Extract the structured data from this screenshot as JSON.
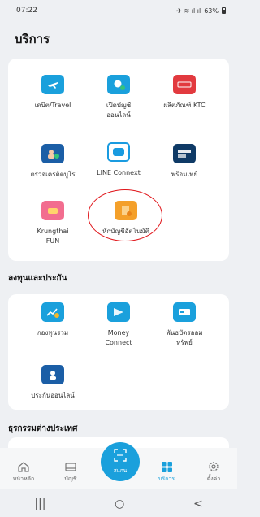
{
  "status_bar": {
    "time": "07:22",
    "icons_text": "✈︎ ≋ ıl ıl",
    "battery": "63%"
  },
  "page": {
    "title": "บริการ"
  },
  "services": [
    {
      "label": "เดบิต/Travel",
      "icon": "travel-card-icon"
    },
    {
      "label": "เปิดบัญชี\nออนไลน์",
      "icon": "open-account-icon"
    },
    {
      "label": "ผลิตภัณฑ์ KTC",
      "icon": "ktc-icon"
    },
    {
      "label": "ตรวจเครดิตบูโร",
      "icon": "credit-bureau-icon"
    },
    {
      "label": "LINE Connext",
      "icon": "line-connext-icon"
    },
    {
      "label": "พร้อมเพย์",
      "icon": "promptpay-icon"
    },
    {
      "label": "Krungthai\nFUN",
      "icon": "krungthai-fun-icon"
    },
    {
      "label": "หักบัญชีอัตโนมัติ",
      "icon": "auto-debit-icon"
    }
  ],
  "invest_section": {
    "title": "ลงทุนและประกัน",
    "items": [
      {
        "label": "กองทุนรวม",
        "icon": "mutual-fund-icon"
      },
      {
        "label": "Money\nConnect",
        "icon": "money-connect-icon"
      },
      {
        "label": "พันธบัตรออม\nทรัพย์",
        "icon": "savings-bond-icon"
      },
      {
        "label": "ประกันออนไลน์",
        "icon": "online-insurance-icon"
      }
    ]
  },
  "foreign_section": {
    "title": "ธุรกรรมต่างประเทศ"
  },
  "bottom_nav": {
    "home": "หน้าหลัก",
    "accounts": "บัญชี",
    "scan": "สแกน",
    "services": "บริการ",
    "settings": "ตั้งค่า"
  },
  "system_nav": {
    "recents": "|||",
    "home": "○",
    "back": "<"
  },
  "colors": {
    "accent": "#1aa0dc",
    "highlight_circle": "#e0161b",
    "ktc": "#e23a3f"
  }
}
